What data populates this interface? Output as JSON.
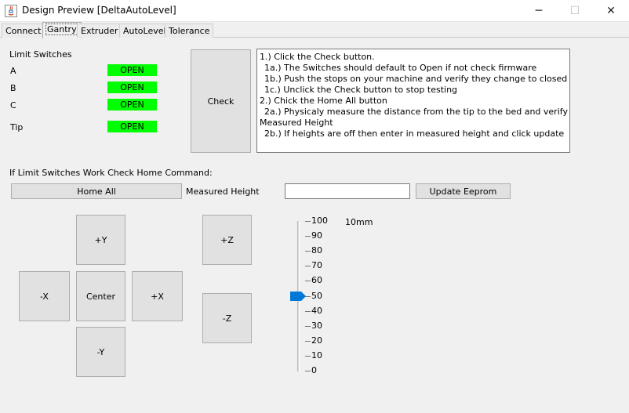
{
  "window": {
    "title": "Design Preview [DeltaAutoLevel]",
    "minimize_glyph": "─",
    "maximize_glyph": "☐",
    "close_glyph": "✕"
  },
  "tabs": [
    "Connect",
    "Gantry",
    "Extruder",
    "AutoLevel",
    "Tolerance"
  ],
  "active_tab": "Gantry",
  "limit_switches": {
    "heading": "Limit Switches",
    "items": [
      {
        "label": "A",
        "status": "OPEN"
      },
      {
        "label": "B",
        "status": "OPEN"
      },
      {
        "label": "C",
        "status": "OPEN"
      },
      {
        "label": "Tip",
        "status": "OPEN"
      }
    ],
    "status_color": "#00ff00"
  },
  "check_button": "Check",
  "instructions": [
    "1.) Click the Check button.",
    "  1a.) The Switches should default to Open if not check firmware",
    "  1b.) Push the stops on your machine and verify they change to closed",
    "  1c.) Unclick the Check button to stop testing",
    "2.) Chick the Home All button",
    "  2a.) Physicaly measure the distance from the tip to the bed and verify",
    "Measured Height",
    "  2b.) If heights are off then enter in measured height and click update"
  ],
  "home_section": {
    "heading": "If Limit Switches Work Check Home Command:",
    "home_all": "Home All",
    "measured_height_label": "Measured Height",
    "measured_height_value": "",
    "update_button": "Update Eeprom"
  },
  "jog": {
    "plus_y": "+Y",
    "minus_x": "-X",
    "center": "Center",
    "plus_x": "+X",
    "minus_y": "-Y",
    "plus_z": "+Z",
    "minus_z": "-Z"
  },
  "slider": {
    "labels": [
      "100",
      "90",
      "80",
      "70",
      "60",
      "50",
      "40",
      "30",
      "20",
      "10",
      "0"
    ],
    "min": 0,
    "max": 100,
    "value": 50,
    "unit_label": "10mm",
    "thumb_color": "#0078d7"
  }
}
